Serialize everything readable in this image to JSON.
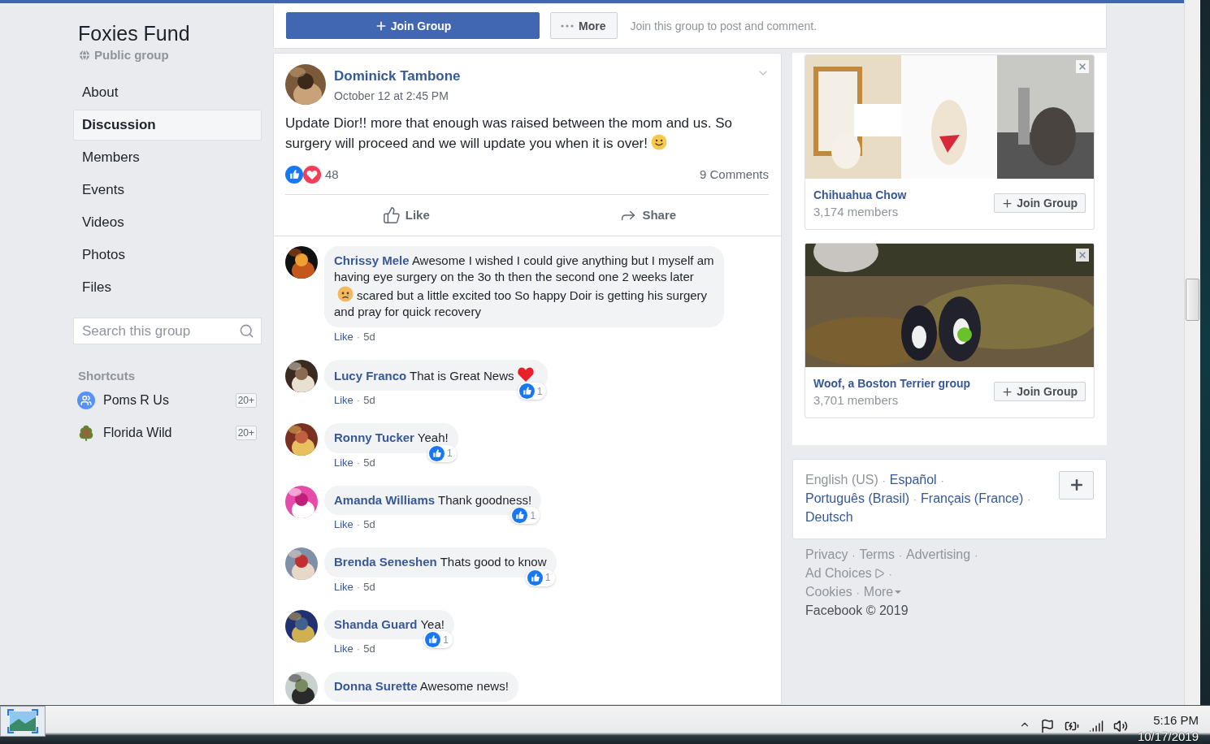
{
  "group": {
    "name": "Foxies Fund",
    "privacy": "Public group"
  },
  "nav": [
    {
      "label": "About",
      "selected": false
    },
    {
      "label": "Discussion",
      "selected": true
    },
    {
      "label": "Members",
      "selected": false
    },
    {
      "label": "Events",
      "selected": false
    },
    {
      "label": "Videos",
      "selected": false
    },
    {
      "label": "Photos",
      "selected": false
    },
    {
      "label": "Files",
      "selected": false
    }
  ],
  "search": {
    "placeholder": "Search this group"
  },
  "shortcuts": {
    "title": "Shortcuts",
    "items": [
      {
        "label": "Poms R Us",
        "badge": "20+",
        "kind": "people"
      },
      {
        "label": "Florida Wild",
        "badge": "20+",
        "kind": "tree"
      }
    ]
  },
  "join_bar": {
    "join_label": "Join Group",
    "more_label": "More",
    "hint": "Join this group to post and comment."
  },
  "post": {
    "author": "Dominick Tambone",
    "time": "October 12 at 2:45 PM",
    "body": [
      {
        "kind": "text",
        "text": "Update Dior!! more that enough was raised between the mom and us. So surgery will proceed and we will update you when it is over!"
      },
      {
        "kind": "smile"
      }
    ],
    "reaction_count": "48",
    "comments_count": "9 Comments",
    "like_label": "Like",
    "share_label": "Share"
  },
  "comment_separator": "·",
  "comments": [
    {
      "author": "Chrissy Mele",
      "body": [
        {
          "kind": "text",
          "text": "Awesome I wished I could give anything but I myself am having eye surgery on the 3o th then the second one 2 weeks later"
        },
        {
          "kind": "worried"
        },
        {
          "kind": "text",
          "text": "scared but a little excited too So happy Doir is getting his surgery and pray for quick recovery"
        }
      ],
      "like_label": "Like",
      "age": "5d"
    },
    {
      "author": "Lucy Franco",
      "body": [
        {
          "kind": "text",
          "text": "That is Great News"
        },
        {
          "kind": "heart"
        }
      ],
      "like_label": "Like",
      "age": "5d",
      "reaction_count": "1"
    },
    {
      "author": "Ronny Tucker",
      "body": [
        {
          "kind": "text",
          "text": "Yeah!"
        }
      ],
      "like_label": "Like",
      "age": "5d",
      "reaction_count": "1"
    },
    {
      "author": "Amanda Williams",
      "body": [
        {
          "kind": "text",
          "text": "Thank goodness!"
        }
      ],
      "like_label": "Like",
      "age": "5d",
      "reaction_count": "1"
    },
    {
      "author": "Brenda Seneshen",
      "body": [
        {
          "kind": "text",
          "text": "Thats good to know"
        }
      ],
      "like_label": "Like",
      "age": "5d",
      "reaction_count": "1"
    },
    {
      "author": "Shanda Guard",
      "body": [
        {
          "kind": "text",
          "text": "Yea!"
        }
      ],
      "like_label": "Like",
      "age": "5d",
      "reaction_count": "1"
    },
    {
      "author": "Donna Surette",
      "body": [
        {
          "kind": "text",
          "text": "Awesome news!"
        }
      ]
    }
  ],
  "suggestions": [
    {
      "name": "Chihuahua Chow",
      "members": "3,174 members",
      "join_label": "Join Group",
      "kind": "picture"
    },
    {
      "name": "Woof, a Boston Terrier group",
      "members": "3,701 members",
      "join_label": "Join Group",
      "kind": "picture"
    }
  ],
  "languages": {
    "separator": "·",
    "items": [
      {
        "label": "English (US)",
        "selected": true
      },
      {
        "label": "Español",
        "selected": false
      },
      {
        "label": "Português (Brasil)",
        "selected": false
      },
      {
        "label": "Français (France)",
        "selected": false
      },
      {
        "label": "Deutsch",
        "selected": false
      }
    ]
  },
  "footer": {
    "separator": "·",
    "links": [
      {
        "label": "Privacy",
        "kind": "plain"
      },
      {
        "label": "Terms",
        "kind": "plain"
      },
      {
        "label": "Advertising",
        "kind": "plain"
      },
      {
        "label": "Ad Choices",
        "kind": "adchoices"
      },
      {
        "label": "Cookies",
        "kind": "plain"
      },
      {
        "label": "More",
        "kind": "menu"
      }
    ],
    "copyright": "Facebook © 2019"
  },
  "taskbar": {
    "time": "5:16 PM",
    "date": "10/17/2019"
  }
}
